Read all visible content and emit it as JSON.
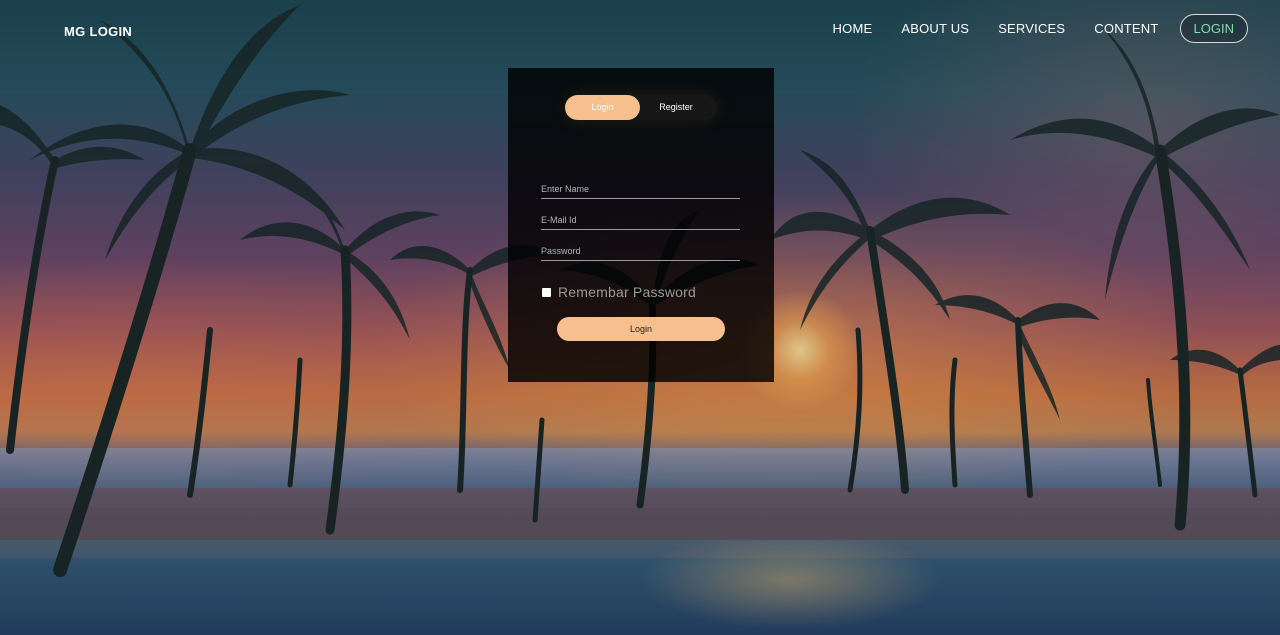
{
  "brand": "MG LOGIN",
  "nav": {
    "items": [
      "HOME",
      "ABOUT US",
      "SERVICES",
      "CONTENT"
    ],
    "login": "LOGIN"
  },
  "form": {
    "toggle_login": "Login",
    "toggle_register": "Register",
    "name_placeholder": "Enter Name",
    "email_placeholder": "E-Mail Id",
    "password_placeholder": "Password",
    "remember_label": "Remembar Password",
    "submit_label": "Login"
  },
  "colors": {
    "accent": "#f5c08e",
    "nav_login_text": "#7ee0b0"
  }
}
